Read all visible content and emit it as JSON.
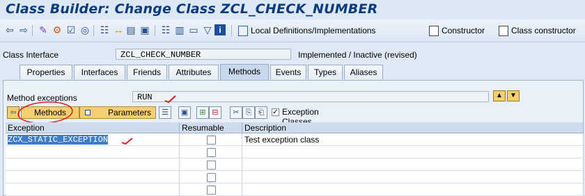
{
  "title": "Class Builder: Change Class ZCL_CHECK_NUMBER",
  "toolbar": {
    "icons": [
      "back-arrow-icon",
      "forward-arrow-icon",
      "edit-icon",
      "activate-icon",
      "check-icon",
      "where-used-icon",
      "hierarchy-icon",
      "object-list-icon",
      "enhance-icon",
      "display-object-icon",
      "layout-icon",
      "filter-icon",
      "info-icon"
    ],
    "local_defs_label": "Local Definitions/Implementations",
    "constructor_label": "Constructor",
    "class_constructor_label": "Class constructor"
  },
  "header": {
    "class_interface_label": "Class Interface",
    "class_interface_value": "ZCL_CHECK_NUMBER",
    "status_text": "Implemented / Inactive (revised)"
  },
  "tabs": [
    "Properties",
    "Interfaces",
    "Friends",
    "Attributes",
    "Methods",
    "Events",
    "Types",
    "Aliases"
  ],
  "active_tab": "Methods",
  "method_exceptions": {
    "label": "Method exceptions",
    "value": "RUN"
  },
  "buttons": {
    "methods_label": "Methods",
    "parameters_label": "Parameters",
    "exception_classes_label": "Exception Classes",
    "exception_classes_checked": true
  },
  "table": {
    "columns": [
      "Exception",
      "Resumable",
      "Description"
    ],
    "rows": [
      {
        "exception": "ZCX_STATIC_EXCEPTION",
        "resumable": false,
        "description": "Test exception class"
      },
      {
        "exception": "",
        "resumable": false,
        "description": ""
      },
      {
        "exception": "",
        "resumable": false,
        "description": ""
      },
      {
        "exception": "",
        "resumable": false,
        "description": ""
      },
      {
        "exception": "",
        "resumable": false,
        "description": ""
      }
    ]
  },
  "colors": {
    "title": "#0a3a80",
    "annotation_red": "#e0191f",
    "button_yellow": "#f4cf6e",
    "selection_blue": "#3d7cc9"
  }
}
